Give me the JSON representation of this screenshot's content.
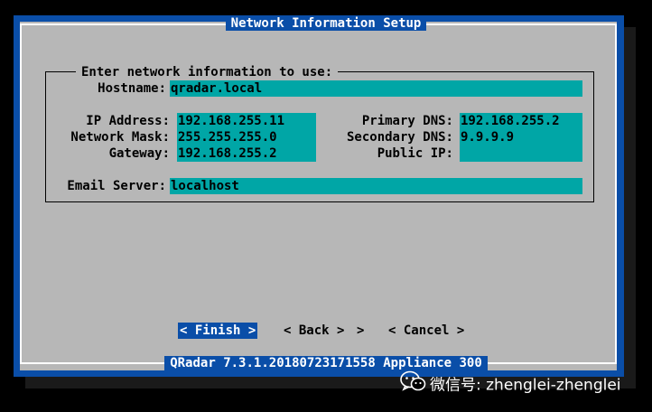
{
  "dialog": {
    "title": "Network Information Setup",
    "group_label": "Enter network information to use:",
    "footer": "QRadar 7.3.1.20180723171558 Appliance 300"
  },
  "fields": {
    "hostname": {
      "label": "Hostname:",
      "value": "qradar.local"
    },
    "ip_address": {
      "label": "IP Address:",
      "value": "192.168.255.11"
    },
    "network_mask": {
      "label": "Network Mask:",
      "value": "255.255.255.0"
    },
    "gateway": {
      "label": "Gateway:",
      "value": "192.168.255.2"
    },
    "primary_dns": {
      "label": "Primary DNS:",
      "value": "192.168.255.2"
    },
    "secondary_dns": {
      "label": "Secondary DNS:",
      "value": "9.9.9.9"
    },
    "public_ip": {
      "label": "Public IP:",
      "value": ""
    },
    "email_server": {
      "label": "Email Server:",
      "value": "localhost"
    }
  },
  "buttons": {
    "finish": "< Finish >",
    "back": "< Back >",
    "arrow": ">",
    "cancel": "< Cancel >"
  },
  "watermark": {
    "text": "微信号: zhenglei-zhenglei",
    "icon": "wechat-icon"
  }
}
